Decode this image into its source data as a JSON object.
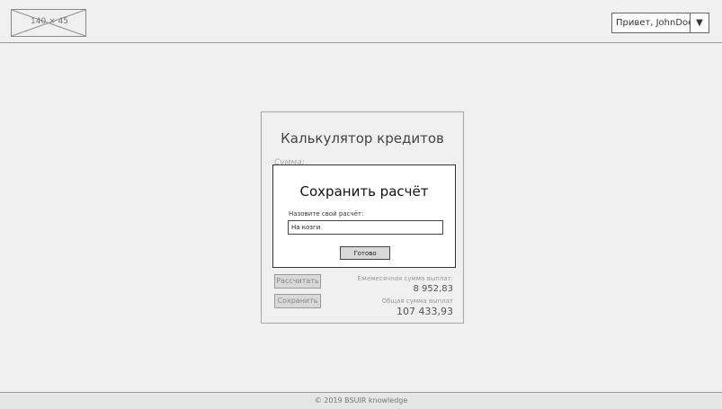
{
  "header": {
    "logo_placeholder": "140 × 45",
    "user_menu_label": "Привет, JohnDoe!",
    "user_menu_arrow": "▼"
  },
  "calculator": {
    "title": "Калькулятор кредитов",
    "amount_label": "Сумма:",
    "calculate_button": "Рассчитать",
    "save_button": "Сохранить",
    "monthly_payment_label": "Ежемесячная сумма выплат:",
    "monthly_payment_value": "8 952,83",
    "total_payment_label": "Общая сумма выплат",
    "total_payment_value": "107 433,93"
  },
  "modal": {
    "title": "Сохранить расчёт",
    "name_label": "Назовите свой расчёт:",
    "name_value": "На козги",
    "done_button": "Готово"
  },
  "footer": {
    "copyright": "© 2019 BSUIR knowledge"
  }
}
